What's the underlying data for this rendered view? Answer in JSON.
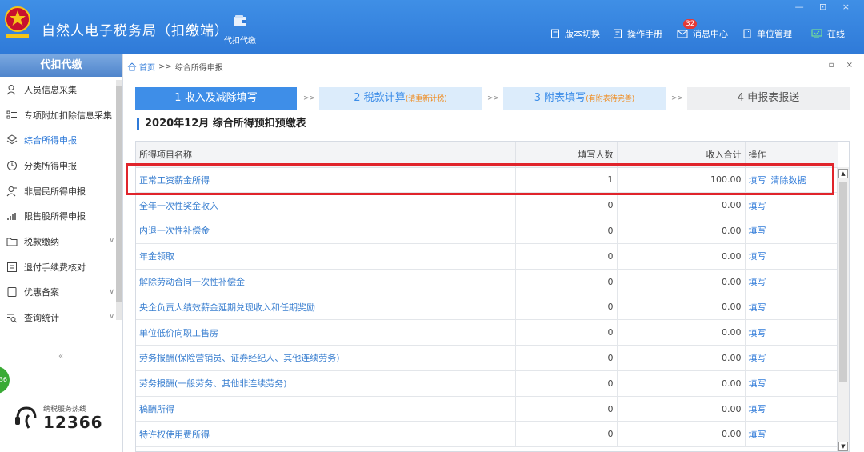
{
  "header": {
    "title": "自然人电子税务局（扣缴端）",
    "module_label": "代扣代缴",
    "window_controls": "— ⊡ ×",
    "top_items": [
      {
        "label": "版本切换",
        "icon": "document-icon"
      },
      {
        "label": "操作手册",
        "icon": "manual-icon"
      },
      {
        "label": "消息中心",
        "icon": "mail-icon",
        "badge": "32"
      },
      {
        "label": "单位管理",
        "icon": "building-icon"
      },
      {
        "label": "在线",
        "icon": "online-monitor-icon"
      }
    ]
  },
  "sidebar": {
    "title": "代扣代缴",
    "items": [
      {
        "label": "人员信息采集",
        "icon": "person-icon"
      },
      {
        "label": "专项附加扣除信息采集",
        "icon": "list-icon"
      },
      {
        "label": "综合所得申报",
        "icon": "layers-icon",
        "active": true
      },
      {
        "label": "分类所得申报",
        "icon": "clock-icon"
      },
      {
        "label": "非居民所得申报",
        "icon": "person-outline-icon"
      },
      {
        "label": "限售股所得申报",
        "icon": "chart-icon"
      },
      {
        "label": "税款缴纳",
        "icon": "folder-icon",
        "expandable": true
      },
      {
        "label": "退付手续费核对",
        "icon": "checklist-icon"
      },
      {
        "label": "优惠备案",
        "icon": "document-icon",
        "expandable": true
      },
      {
        "label": "查询统计",
        "icon": "search-list-icon",
        "expandable": true
      }
    ],
    "collapse_glyph": "«",
    "hotline_label": "纳税服务热线",
    "hotline_number": "12366",
    "badge_text": "36"
  },
  "breadcrumb": {
    "home": "首页",
    "separator": ">>",
    "current": "综合所得申报"
  },
  "main_controls": "▫ ×",
  "steps": [
    {
      "label": "1 收入及减除填写",
      "note": ""
    },
    {
      "label": "2 税款计算",
      "note": "(请重新计税)"
    },
    {
      "label": "3 附表填写",
      "note": "(有附表待完善)"
    },
    {
      "label": "4 申报表报送",
      "note": ""
    }
  ],
  "step_arrow": ">>",
  "page_title": "2020年12月  综合所得预扣预缴表",
  "table": {
    "headers": {
      "name": "所得项目名称",
      "count": "填写人数",
      "income": "收入合计",
      "op": "操作"
    },
    "rows": [
      {
        "name": "正常工资薪金所得",
        "count": "1",
        "income": "100.00",
        "ops": [
          "填写",
          "清除数据"
        ]
      },
      {
        "name": "全年一次性奖金收入",
        "count": "0",
        "income": "0.00",
        "ops": [
          "填写"
        ]
      },
      {
        "name": "内退一次性补偿金",
        "count": "0",
        "income": "0.00",
        "ops": [
          "填写"
        ]
      },
      {
        "name": "年金领取",
        "count": "0",
        "income": "0.00",
        "ops": [
          "填写"
        ]
      },
      {
        "name": "解除劳动合同一次性补偿金",
        "count": "0",
        "income": "0.00",
        "ops": [
          "填写"
        ]
      },
      {
        "name": "央企负责人绩效薪金延期兑现收入和任期奖励",
        "count": "0",
        "income": "0.00",
        "ops": [
          "填写"
        ]
      },
      {
        "name": "单位低价向职工售房",
        "count": "0",
        "income": "0.00",
        "ops": [
          "填写"
        ]
      },
      {
        "name": "劳务报酬(保险营销员、证券经纪人、其他连续劳务)",
        "count": "0",
        "income": "0.00",
        "ops": [
          "填写"
        ]
      },
      {
        "name": "劳务报酬(一般劳务、其他非连续劳务)",
        "count": "0",
        "income": "0.00",
        "ops": [
          "填写"
        ]
      },
      {
        "name": "稿酬所得",
        "count": "0",
        "income": "0.00",
        "ops": [
          "填写"
        ]
      },
      {
        "name": "特许权使用费所得",
        "count": "0",
        "income": "0.00",
        "ops": [
          "填写"
        ]
      }
    ]
  },
  "colors": {
    "header_blue": "#2f7ad8",
    "step_active": "#3e8ee8",
    "step_pending": "#dcecfb",
    "highlight_red": "#e0242b",
    "note_orange": "#f08a1c"
  }
}
